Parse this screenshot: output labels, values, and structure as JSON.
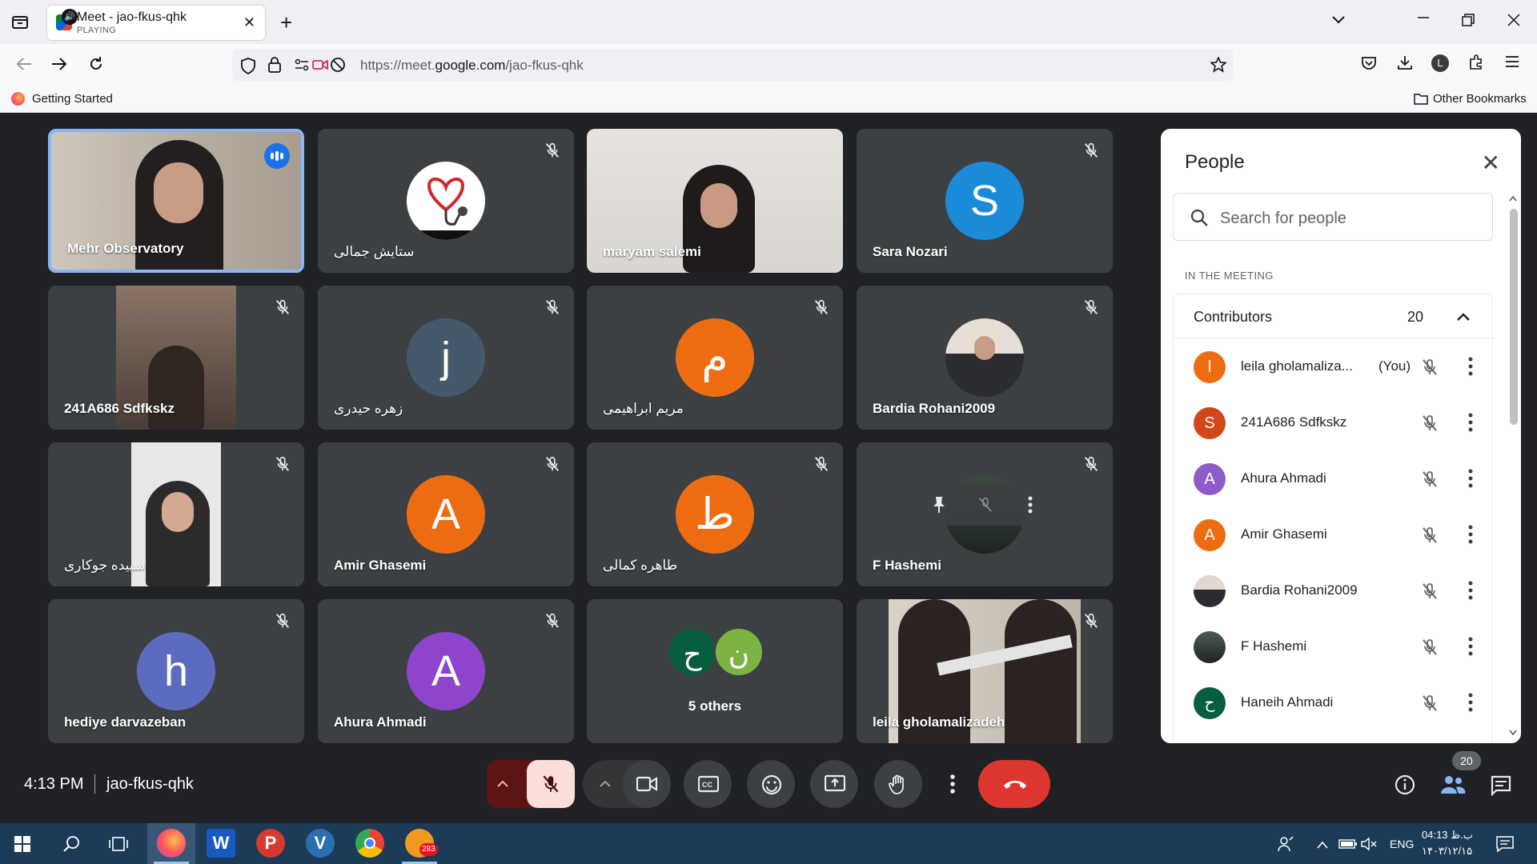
{
  "browser": {
    "tab_title": "Meet - jao-fkus-qhk",
    "tab_status": "PLAYING",
    "url_prefix": "https://meet.",
    "url_domain": "google.com",
    "url_path": "/jao-fkus-qhk",
    "bookmark_1": "Getting Started",
    "bookmark_other": "Other Bookmarks"
  },
  "tiles": [
    {
      "name": "Mehr Observatory"
    },
    {
      "name": "ستایش جمالی"
    },
    {
      "name": "maryam salemi"
    },
    {
      "name": "Sara Nozari",
      "avatar": "S",
      "color": "#1a8ad9"
    },
    {
      "name": "241A686 Sdfkskz"
    },
    {
      "name": "زهره حیدری",
      "avatar": "j",
      "color": "#46596b"
    },
    {
      "name": "مریم ابراهیمی",
      "avatar": "م",
      "color": "#ee6c11"
    },
    {
      "name": "Bardia Rohani2009"
    },
    {
      "name": "سپیده جوکاری"
    },
    {
      "name": "Amir Ghasemi",
      "avatar": "A",
      "color": "#ee6c11"
    },
    {
      "name": "طاهره کمالی",
      "avatar": "ط",
      "color": "#ee6c11"
    },
    {
      "name": "F Hashemi"
    },
    {
      "name": "hediye darvazeban",
      "avatar": "h",
      "color": "#5c6bc0"
    },
    {
      "name": "Ahura Ahmadi",
      "avatar": "A",
      "color": "#8e44cc"
    },
    {
      "name": "5 others",
      "avatar_a": "ح",
      "avatar_b": "ن",
      "color_a": "#075e3f",
      "color_b": "#7cb342"
    },
    {
      "name": "leila gholamalizadeh"
    }
  ],
  "people": {
    "title": "People",
    "search_placeholder": "Search for people",
    "section": "IN THE MEETING",
    "group_label": "Contributors",
    "group_count": "20",
    "list": [
      {
        "name": "leila gholamaliza...",
        "you": "(You)",
        "avatar": "l",
        "color": "#ee6c11"
      },
      {
        "name": "241A686 Sdfkskz",
        "avatar": "S",
        "color": "#d2471a"
      },
      {
        "name": "Ahura Ahmadi",
        "avatar": "A",
        "color": "#8e5cc9"
      },
      {
        "name": "Amir Ghasemi",
        "avatar": "A",
        "color": "#ee6c11"
      },
      {
        "name": "Bardia Rohani2009",
        "avatar": "",
        "color": "#8d7b6c"
      },
      {
        "name": "F Hashemi",
        "avatar": "",
        "color": "#2d3b33"
      },
      {
        "name": "Haneih Ahmadi",
        "avatar": "ح",
        "color": "#075e3f"
      }
    ]
  },
  "bottom": {
    "time": "4:13 PM",
    "meeting_code": "jao-fkus-qhk",
    "people_badge": "20"
  },
  "taskbar": {
    "lang": "ENG",
    "tray_time": "04:13 ب.ظ",
    "tray_date": "۱۴۰۳/۱۲/۱۵",
    "badge": "283"
  }
}
